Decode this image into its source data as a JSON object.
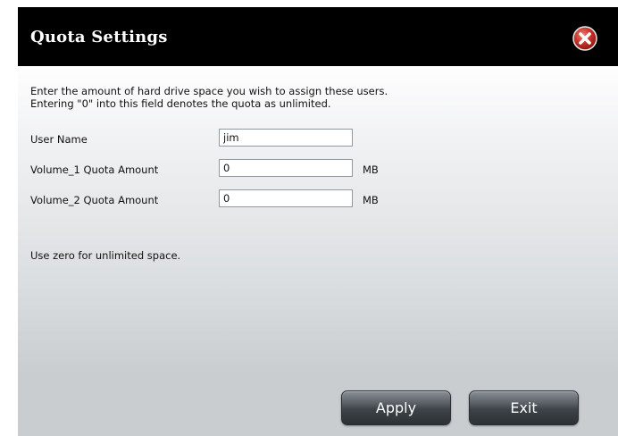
{
  "dialog": {
    "title": "Quota Settings",
    "description_line1": "Enter the amount of hard drive space you wish to assign these users.",
    "description_line2": "Entering \"0\" into this field denotes the quota as unlimited.",
    "hint": "Use zero for unlimited space."
  },
  "form": {
    "user_name": {
      "label": "User Name",
      "value": "jim"
    },
    "volume1": {
      "label": "Volume_1 Quota Amount",
      "value": "0",
      "unit": "MB"
    },
    "volume2": {
      "label": "Volume_2 Quota Amount",
      "value": "0",
      "unit": "MB"
    }
  },
  "buttons": {
    "apply": "Apply",
    "exit": "Exit"
  },
  "icons": {
    "close": "close-icon"
  },
  "colors": {
    "titlebar": "#000000",
    "close_red": "#c8322a"
  }
}
